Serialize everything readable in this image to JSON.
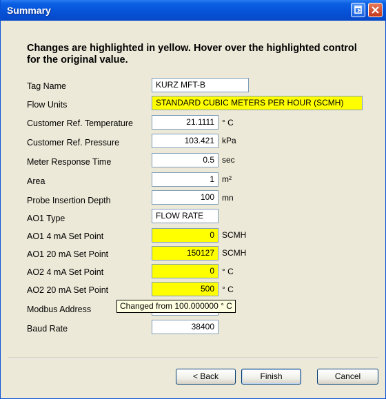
{
  "window": {
    "title": "Summary",
    "restore_icon": "restore-icon",
    "close_icon": "close-icon"
  },
  "instructions": "Changes are highlighted in yellow.  Hover over the highlighted control for the original value.",
  "fields": {
    "tag_name": {
      "label": "Tag Name",
      "value": "KURZ MFT-B",
      "unit": ""
    },
    "flow_units": {
      "label": "Flow Units",
      "value": "STANDARD CUBIC METERS PER HOUR (SCMH)",
      "unit": "",
      "changed": true
    },
    "customer_ref_temperature": {
      "label": "Customer Ref. Temperature",
      "value": "21.1111",
      "unit": "° C"
    },
    "customer_ref_pressure": {
      "label": "Customer Ref. Pressure",
      "value": "103.421",
      "unit": "kPa"
    },
    "meter_response_time": {
      "label": "Meter Response Time",
      "value": "0.5",
      "unit": "sec"
    },
    "area": {
      "label": "Area",
      "value": "1",
      "unit": "m²"
    },
    "probe_insertion_depth": {
      "label": "Probe Insertion Depth",
      "value": "100",
      "unit": "mn"
    },
    "ao1_type": {
      "label": "AO1 Type",
      "value": "FLOW RATE",
      "unit": ""
    },
    "ao1_4ma_set_point": {
      "label": "AO1 4 mA Set Point",
      "value": "0",
      "unit": "SCMH",
      "changed": true
    },
    "ao1_20ma_set_point": {
      "label": "AO1 20 mA Set Point",
      "value": "150127",
      "unit": "SCMH",
      "changed": true
    },
    "ao2_4ma_set_point": {
      "label": "AO2 4 mA Set Point",
      "value": "0",
      "unit": "° C",
      "changed": true
    },
    "ao2_20ma_set_point": {
      "label": "AO2 20 mA Set Point",
      "value": "500",
      "unit": "° C",
      "changed": true
    },
    "modbus_address": {
      "label": "Modbus Address",
      "value": "",
      "unit": ""
    },
    "baud_rate": {
      "label": "Baud Rate",
      "value": "38400",
      "unit": ""
    }
  },
  "tooltip": "Changed from 100.000000 ° C",
  "buttons": {
    "back": "< Back",
    "finish": "Finish",
    "cancel": "Cancel"
  },
  "colors": {
    "title_bar": "#0653d8",
    "highlight": "#ffff00",
    "tooltip_bg": "#ffffe1",
    "dialog_bg": "#ece9d8"
  }
}
